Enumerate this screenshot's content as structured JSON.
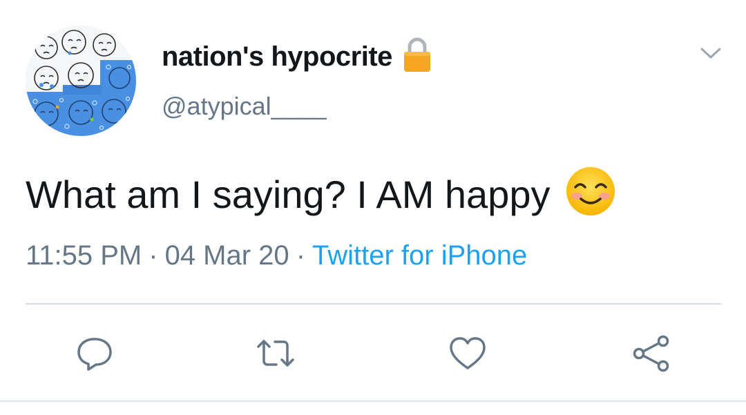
{
  "author": {
    "display_name": "nation's hypocrite",
    "handle": "@atypical____",
    "protected_icon": "lock-icon"
  },
  "tweet": {
    "text": "What am I saying? I AM happy",
    "emoji": "smiling-face-with-smiling-eyes-icon",
    "time": "11:55 PM",
    "separator": "·",
    "date": "04 Mar 20",
    "source": "Twitter for iPhone"
  },
  "actions": {
    "reply_icon": "reply-icon",
    "retweet_icon": "retweet-icon",
    "like_icon": "heart-icon",
    "share_icon": "share-icon"
  },
  "menu_icon": "chevron-down-icon",
  "colors": {
    "text": "#14171a",
    "secondary": "#657786",
    "link": "#1da1f2",
    "divider": "#d3dde6"
  }
}
